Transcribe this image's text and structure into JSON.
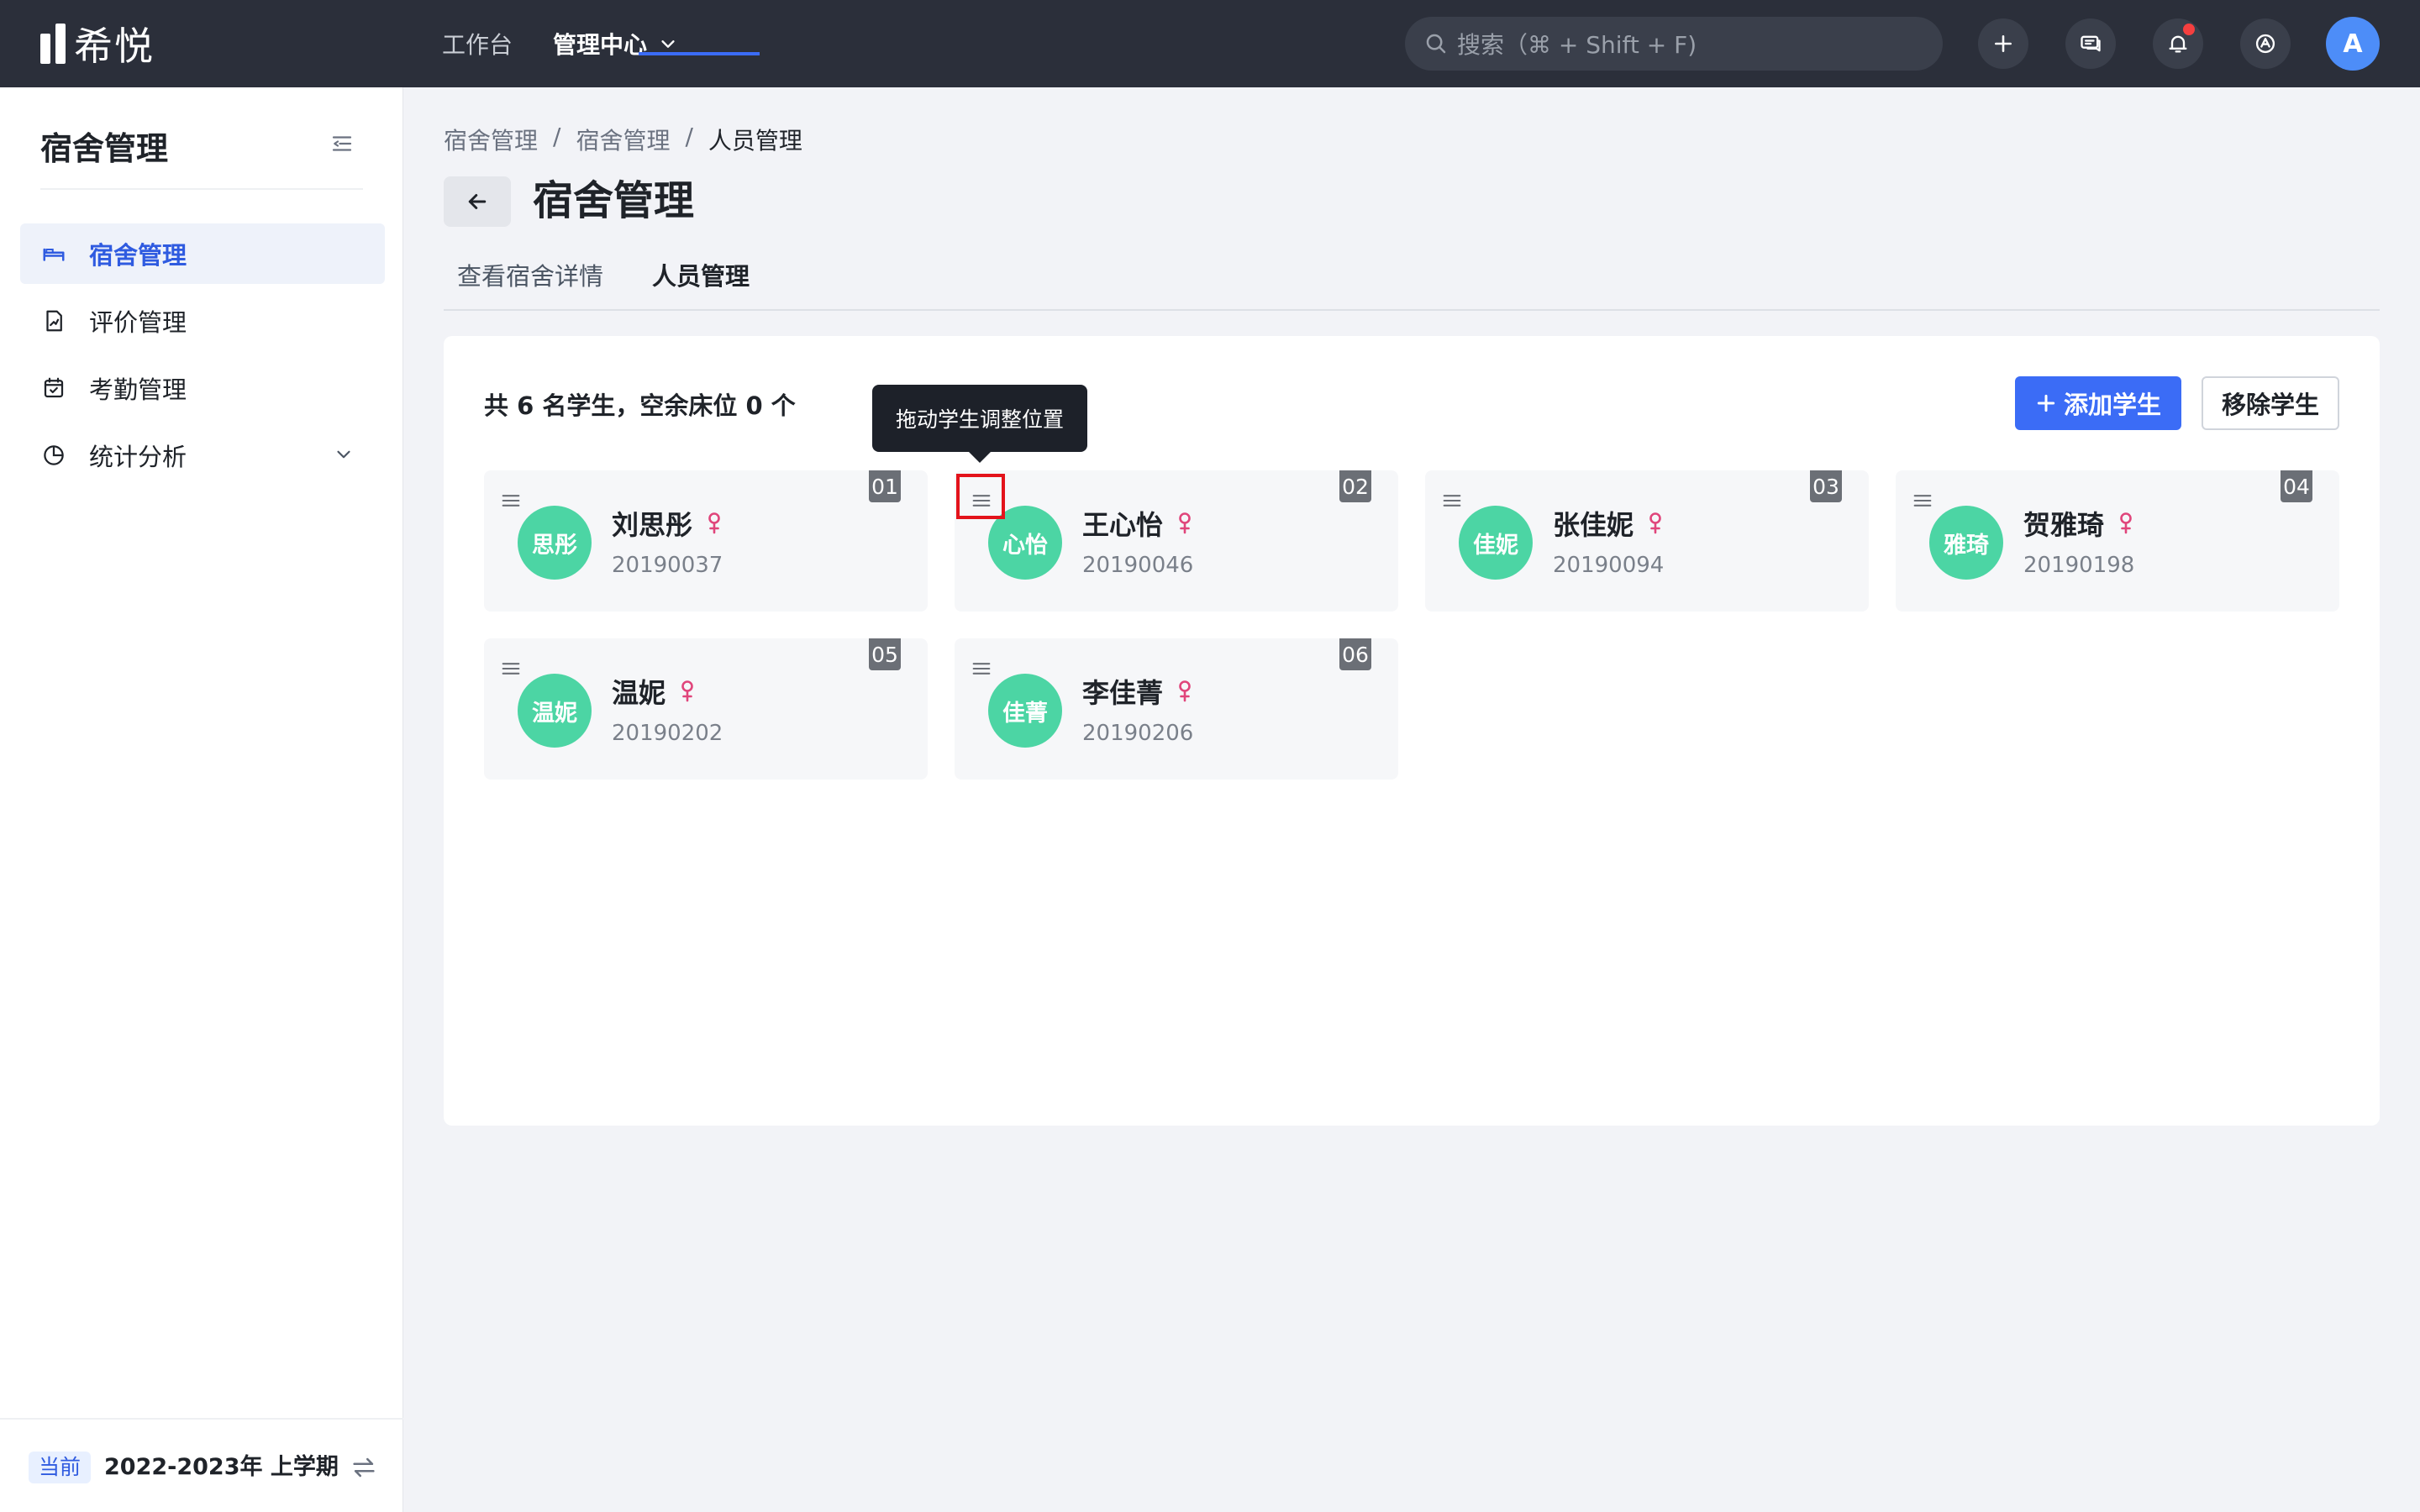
{
  "app": {
    "logo_text": "希悦"
  },
  "topnav": {
    "workbench": "工作台",
    "management_center": "管理中心"
  },
  "search": {
    "placeholder": "搜索（⌘ + Shift + F)"
  },
  "user": {
    "avatar_initial": "A"
  },
  "sidebar": {
    "title": "宿舍管理",
    "items": [
      {
        "label": "宿舍管理",
        "icon": "bed-icon",
        "active": true
      },
      {
        "label": "评价管理",
        "icon": "report-icon"
      },
      {
        "label": "考勤管理",
        "icon": "calendar-icon"
      },
      {
        "label": "统计分析",
        "icon": "pie-chart-icon",
        "has_submenu": true
      }
    ],
    "term": {
      "badge": "当前",
      "label": "2022-2023年 上学期"
    }
  },
  "breadcrumb": [
    "宿舍管理",
    "宿舍管理",
    "人员管理"
  ],
  "page": {
    "title": "宿舍管理",
    "tabs": [
      {
        "label": "查看宿舍详情"
      },
      {
        "label": "人员管理",
        "active": true
      }
    ]
  },
  "panel": {
    "summary": "共 6 名学生，空余床位 0 个",
    "add_button": "添加学生",
    "remove_button": "移除学生",
    "tooltip": "拖动学生调整位置"
  },
  "students": [
    {
      "slot": "01",
      "avatar": "思彤",
      "name": "刘思彤",
      "id": "20190037",
      "gender": "female"
    },
    {
      "slot": "02",
      "avatar": "心怡",
      "name": "王心怡",
      "id": "20190046",
      "gender": "female"
    },
    {
      "slot": "03",
      "avatar": "佳妮",
      "name": "张佳妮",
      "id": "20190094",
      "gender": "female"
    },
    {
      "slot": "04",
      "avatar": "雅琦",
      "name": "贺雅琦",
      "id": "20190198",
      "gender": "female"
    },
    {
      "slot": "05",
      "avatar": "温妮",
      "name": "温妮",
      "id": "20190202",
      "gender": "female"
    },
    {
      "slot": "06",
      "avatar": "佳菁",
      "name": "李佳菁",
      "id": "20190206",
      "gender": "female"
    }
  ],
  "colors": {
    "accent": "#3B6CF6",
    "avatar_green": "#4CD5A4",
    "female_icon": "#E0457B",
    "topbar": "#2B2F3A"
  }
}
